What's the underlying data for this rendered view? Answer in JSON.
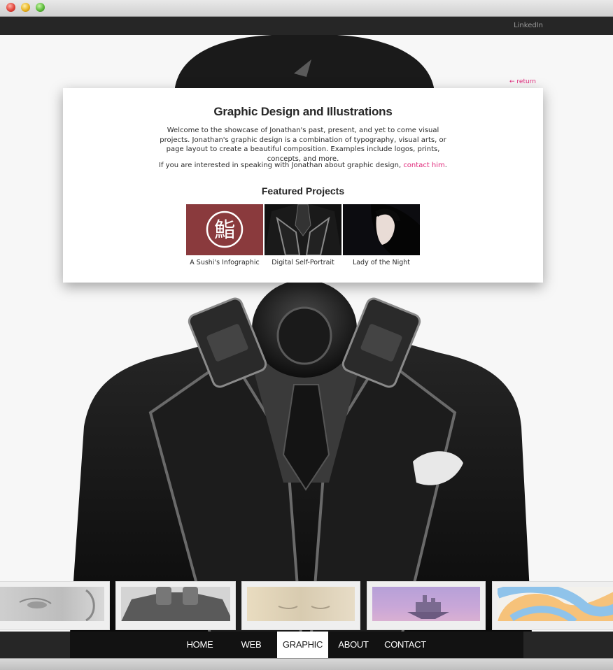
{
  "topbar": {
    "linkedin": "LinkedIn"
  },
  "card": {
    "return_label": "← return",
    "title": "Graphic Design and Illustrations",
    "intro": "Welcome to the showcase of Jonathan's past, present, and yet to come visual projects. Jonathan's graphic design is a combination of typography, visual arts, or page layout to create a beautiful composition. Examples include logos, prints, concepts, and more.",
    "contact_prefix": "If you are interested in speaking with Jonathan about graphic design, ",
    "contact_link": "contact him",
    "contact_suffix": ".",
    "featured_title": "Featured Projects",
    "projects": [
      {
        "caption": "A Sushi's Infographic",
        "glyph": "鮨"
      },
      {
        "caption": "Digital Self-Portrait"
      },
      {
        "caption": "Lady of the Night"
      }
    ]
  },
  "nav": {
    "items": [
      {
        "label": "HOME"
      },
      {
        "label": "WEB"
      },
      {
        "label": "GRAPHIC",
        "active": true
      },
      {
        "label": "ABOUT"
      },
      {
        "label": "CONTACT"
      }
    ]
  },
  "colors": {
    "accent": "#e0287a",
    "sushi_bg": "#8a3a3d",
    "dark_bar": "#262626"
  }
}
